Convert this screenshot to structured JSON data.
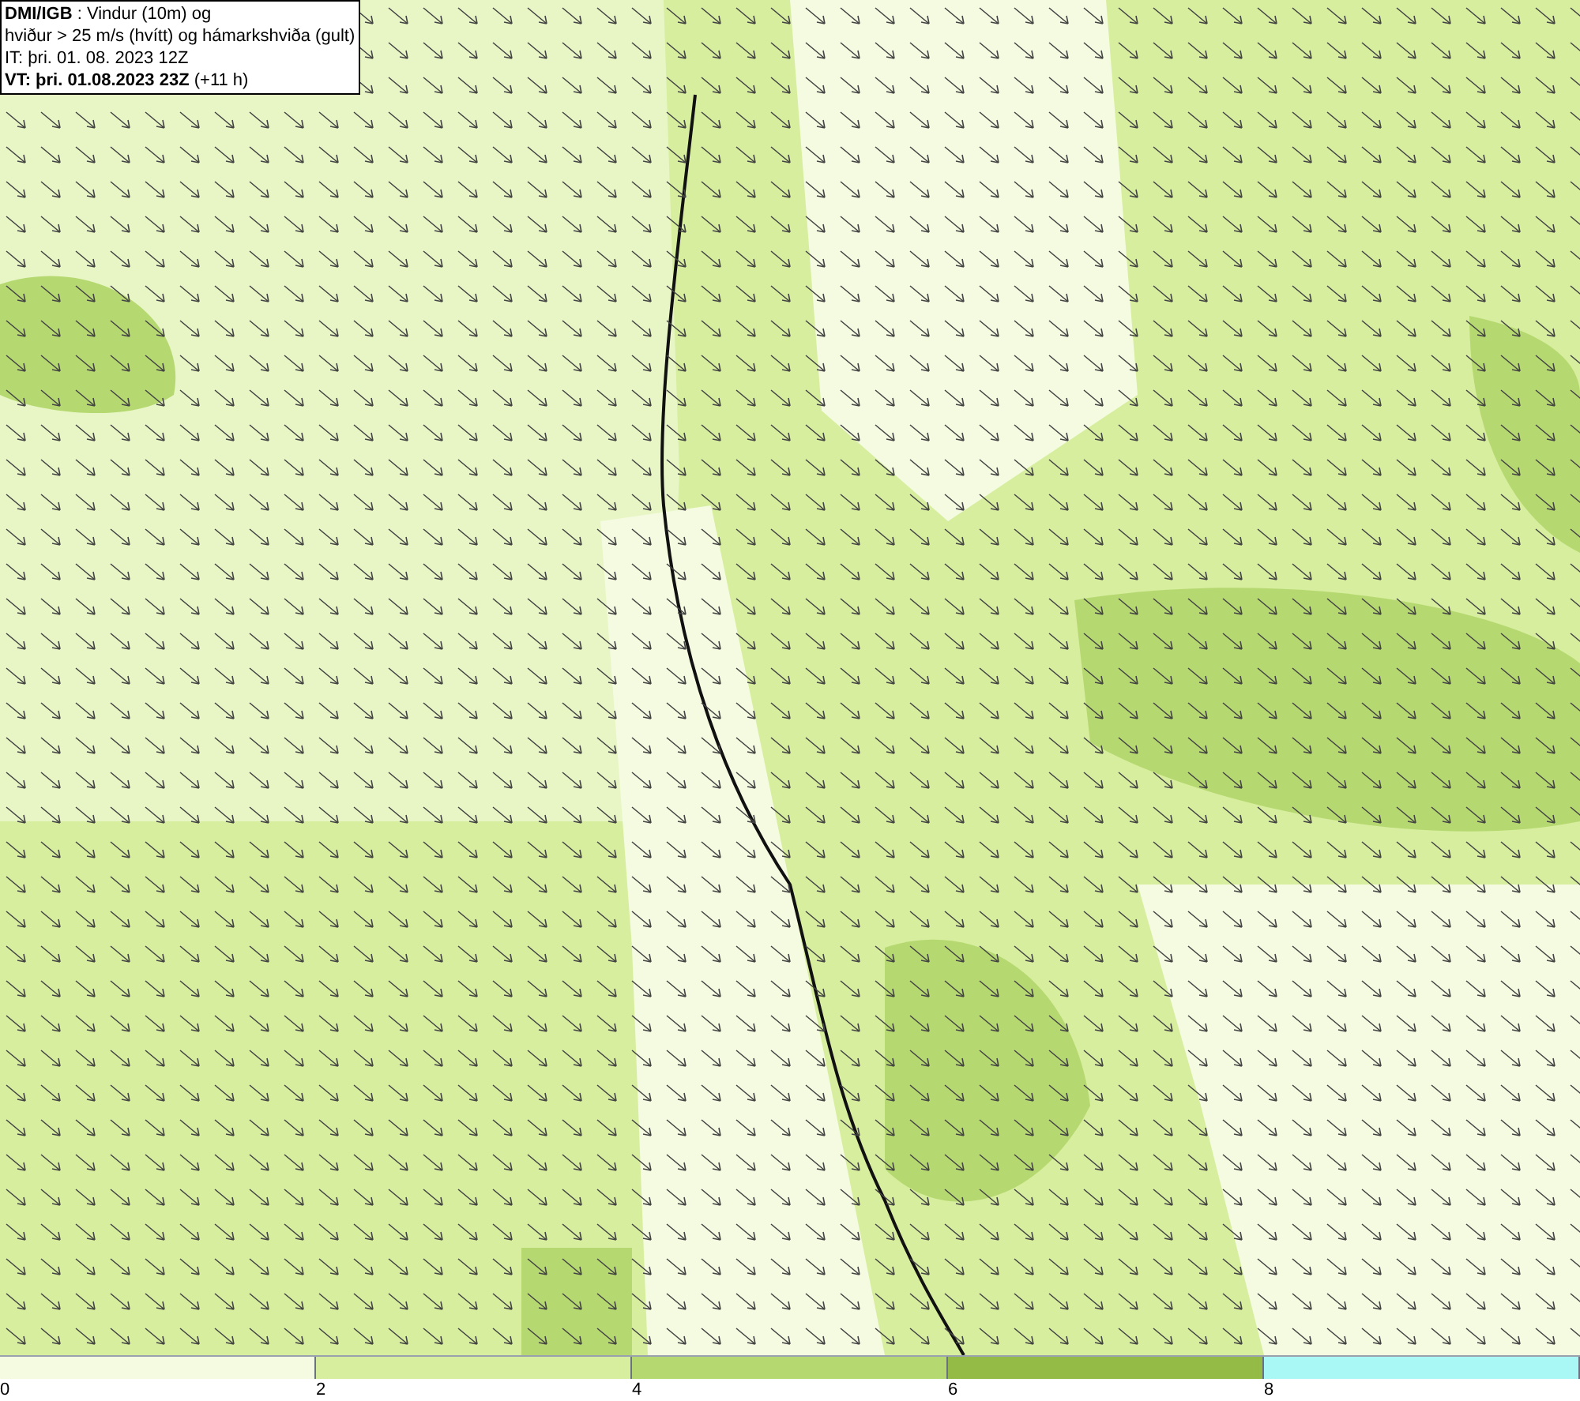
{
  "title_box": {
    "lines": [
      "**DMI/IGB** : Vindur (10m) og",
      "hviður > 25 m/s (hvítt) og hámarkshviða (gult)",
      "IT: þri. 01. 08. 2023 12Z",
      "**VT: þri. 01.08.2023 23Z** (+11 h)"
    ]
  },
  "legend": {
    "segments": [
      {
        "color": "#f4fbe0",
        "label": "0"
      },
      {
        "color": "#d7ee9e",
        "label": "2"
      },
      {
        "color": "#b5d970",
        "label": "4"
      },
      {
        "color": "#93bb46",
        "label": "6"
      },
      {
        "color": "#aaf8f6",
        "label": "8"
      }
    ]
  }
}
